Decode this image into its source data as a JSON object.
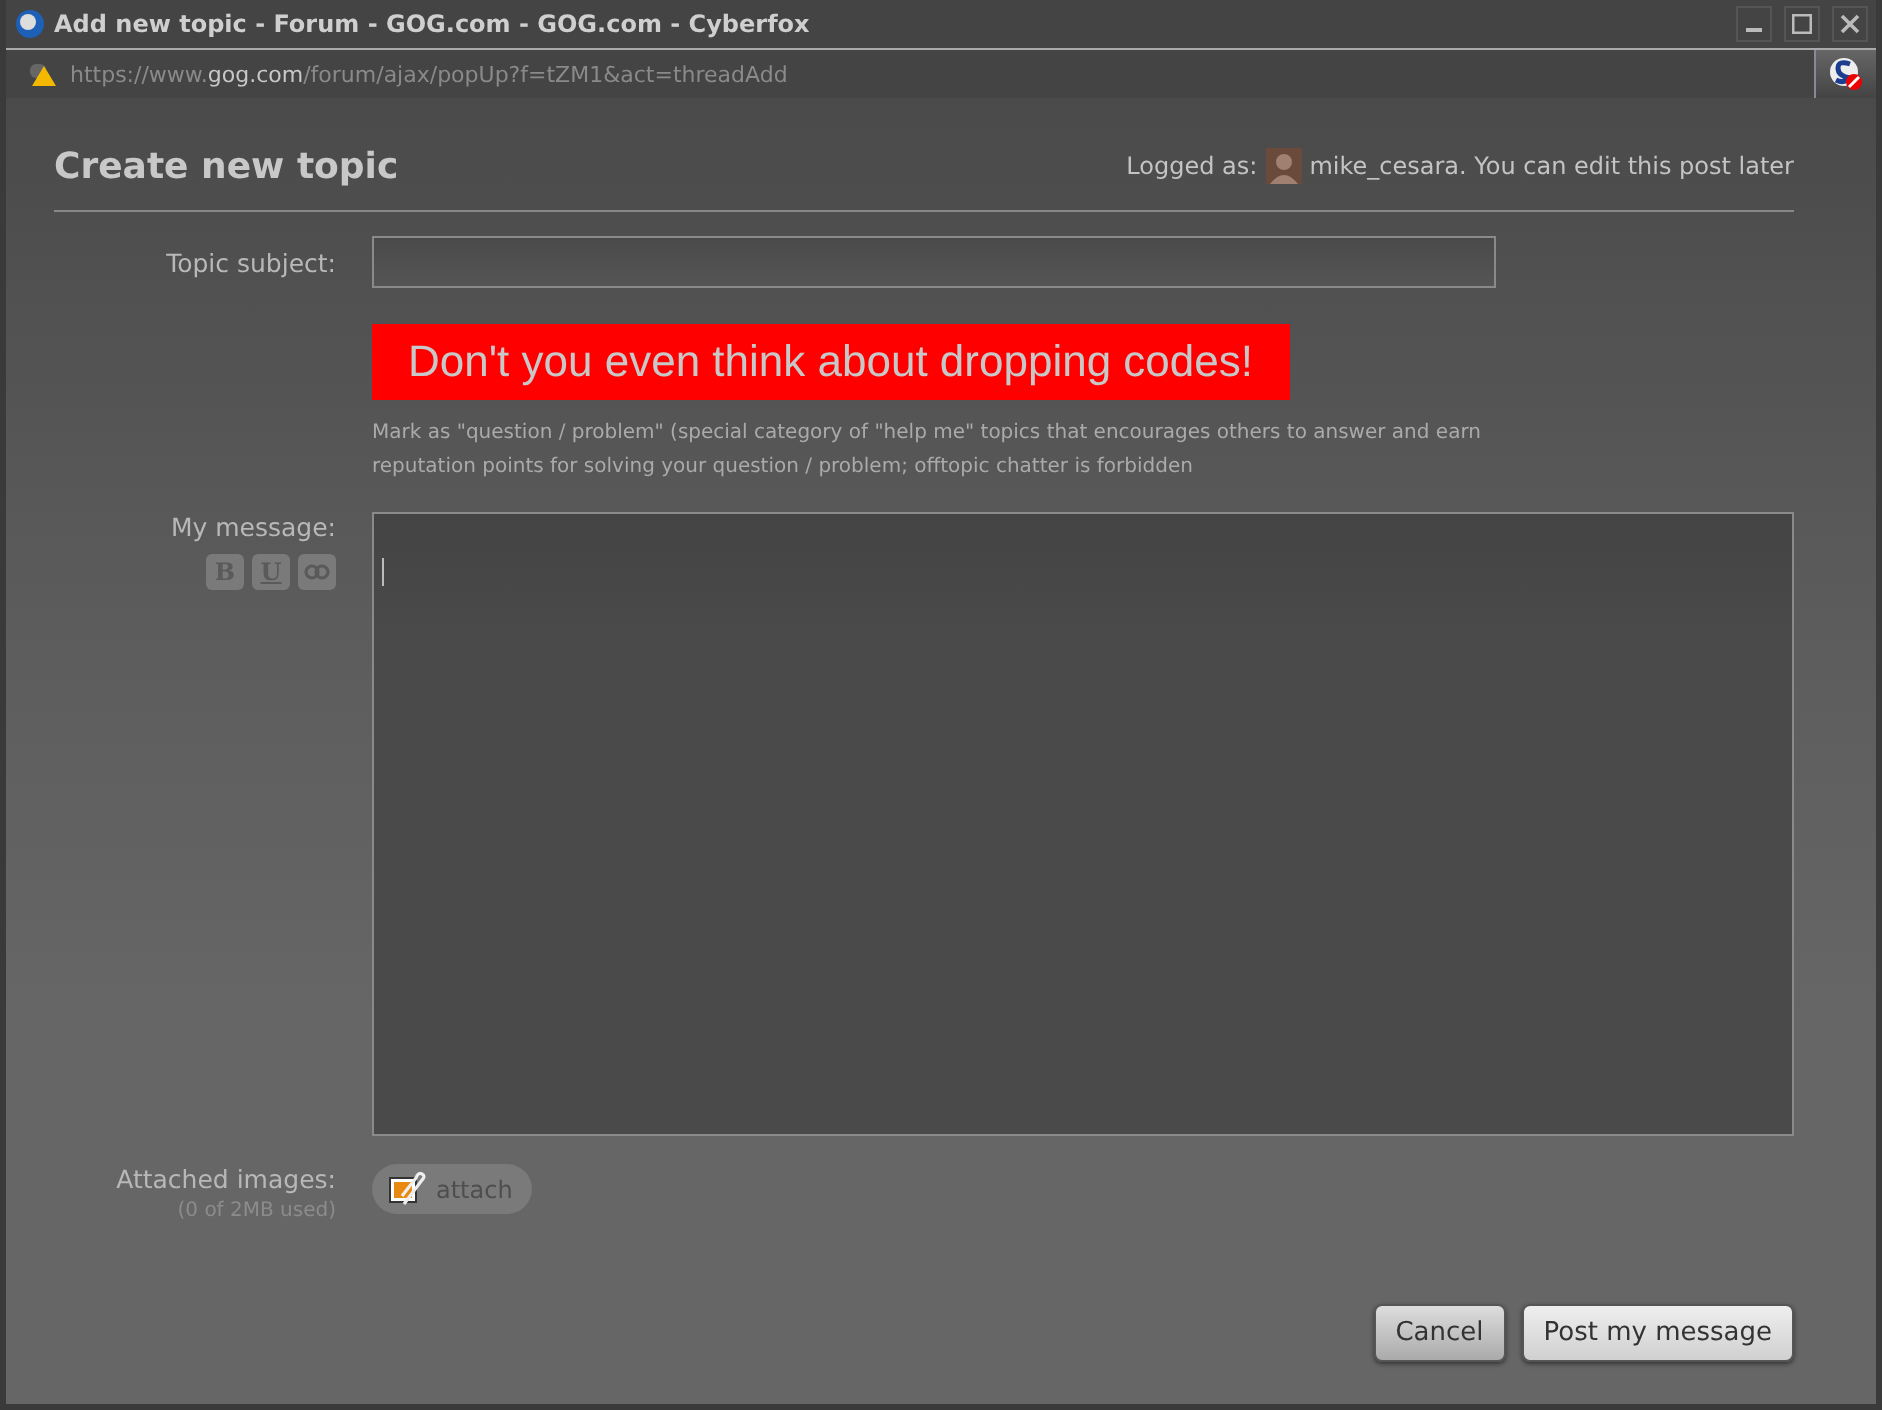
{
  "window": {
    "title": "Add new topic - Forum - GOG.com - GOG.com - Cyberfox"
  },
  "address_bar": {
    "prefix": "https://www.",
    "domain": "gog.com",
    "path": "/forum/ajax/popUp?f=tZM1&act=threadAdd"
  },
  "header": {
    "title": "Create new topic",
    "logged_as": "Logged as:",
    "user_note": "mike_cesara. You can edit this post later"
  },
  "topic_subject": {
    "label": "Topic subject:"
  },
  "banner": "Don't you even think about dropping codes!",
  "hint": "Mark as \"question / problem\" (special category of \"help me\" topics that encourages others to answer and earn reputation points for solving your question / problem; offtopic chatter is forbidden",
  "message": {
    "label": "My message:",
    "tools": [
      {
        "kind": "bold",
        "label": "B"
      },
      {
        "kind": "underline",
        "label": "U"
      },
      {
        "kind": "link"
      }
    ]
  },
  "attachments": {
    "label": "Attached images:",
    "usage": "(0 of 2MB used)",
    "button": "attach"
  },
  "buttons": [
    {
      "label": "Cancel",
      "kind": "secondary"
    },
    {
      "label": "Post my message",
      "kind": "primary"
    }
  ]
}
